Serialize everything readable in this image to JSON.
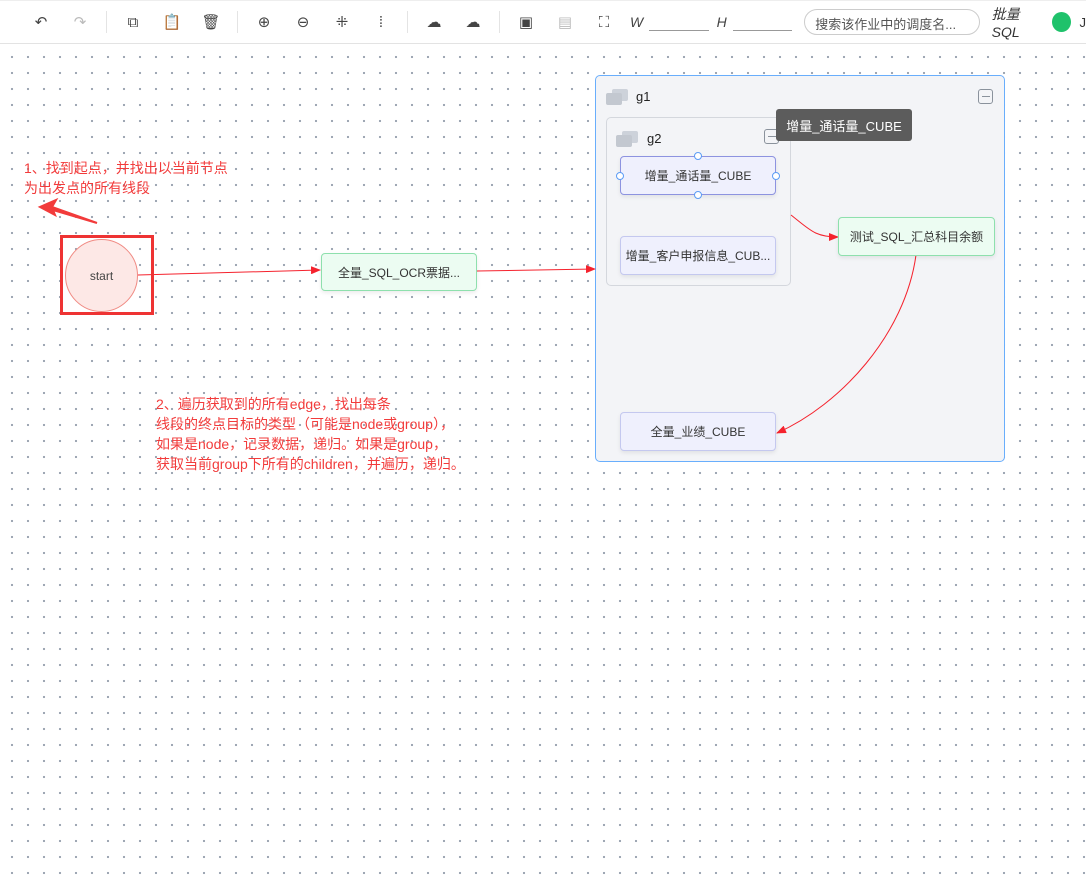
{
  "toolbar": {
    "items": [
      {
        "icon": "undo-icon",
        "glyph": "↶",
        "enabled": true
      },
      {
        "icon": "redo-icon",
        "glyph": "↷",
        "enabled": false
      },
      {
        "icon": "copy-icon",
        "glyph": "⧉",
        "enabled": true
      },
      {
        "icon": "paste-icon",
        "glyph": "📋",
        "enabled": false
      },
      {
        "icon": "delete-icon",
        "glyph": "🗑",
        "enabled": true
      },
      {
        "icon": "zoom-in-icon",
        "glyph": "⊕",
        "enabled": true
      },
      {
        "icon": "zoom-out-icon",
        "glyph": "⊖",
        "enabled": true
      },
      {
        "icon": "fit-view-icon",
        "glyph": "⁜",
        "enabled": true
      },
      {
        "icon": "actual-size-icon",
        "glyph": "⁞",
        "enabled": true
      },
      {
        "icon": "bring-front-icon",
        "glyph": "☁",
        "enabled": true
      },
      {
        "icon": "send-back-icon",
        "glyph": "☁",
        "enabled": true
      },
      {
        "icon": "group-icon",
        "glyph": "▣",
        "enabled": true
      },
      {
        "icon": "ungroup-icon",
        "glyph": "▤",
        "enabled": false
      },
      {
        "icon": "auto-layout-icon",
        "glyph": "⛶",
        "enabled": true
      }
    ],
    "width_label": "W",
    "width_value": "",
    "height_label": "H",
    "height_value": "",
    "search_placeholder": "搜索该作业中的调度名...",
    "tag_label": "批量SQL",
    "status_color": "#1fc26b",
    "trailing_text": "J"
  },
  "nodes": {
    "start": "start",
    "ocr": "全量_SQL_OCR票据...",
    "call_cube": "增量_通话量_CUBE",
    "customer_cube": "增量_客户申报信息_CUB...",
    "summary": "测试_SQL_汇总科目余额",
    "perf_cube": "全量_业绩_CUBE"
  },
  "groups": {
    "g1": "g1",
    "g2": "g2"
  },
  "tooltip": "增量_通话量_CUBE",
  "annotations": {
    "step1": [
      "1、找到起点，并找出以当前节点",
      "为出发点的所有线段"
    ],
    "step2": [
      "2、遍历获取到的所有edge，找出每条",
      "线段的终点目标的类型（可能是node或group），",
      "如果是node，记录数据，递归。如果是group，",
      "获取当前group下所有的children，并遍历，递归。"
    ]
  },
  "colors": {
    "annotation": "#f23b3b",
    "edge": "#f5222d",
    "group_selected": "#69aefc"
  }
}
